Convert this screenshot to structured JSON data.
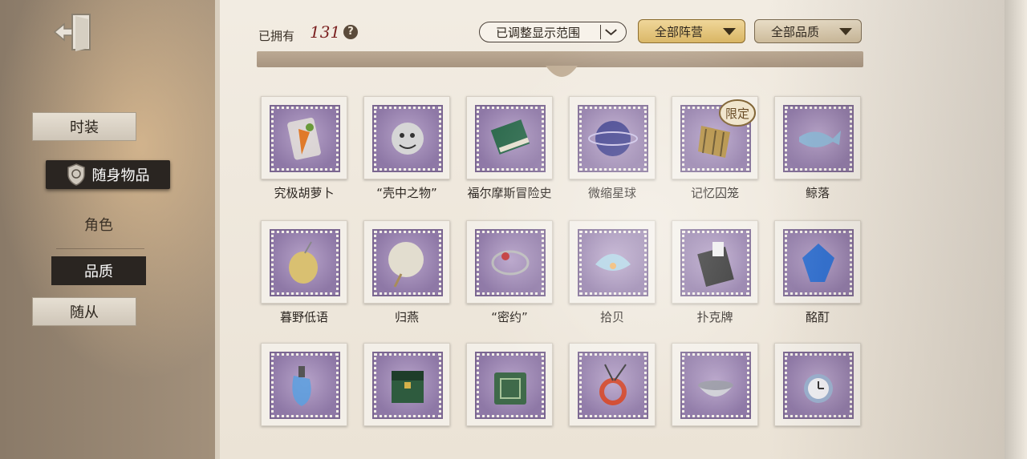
{
  "sidebar": {
    "items": [
      {
        "label": "时装"
      },
      {
        "label": "随身物品"
      },
      {
        "label": "角色"
      },
      {
        "label": "品质"
      },
      {
        "label": "随从"
      }
    ]
  },
  "header": {
    "owned_label": "已拥有",
    "owned_count": "131",
    "help": "?",
    "range_filter": "已调整显示范围",
    "camp_filter": "全部阵营",
    "quality_filter": "全部品质"
  },
  "items": [
    {
      "name": "究极胡萝卜",
      "icon": "carrot-jar-icon",
      "color": "#e07a2a"
    },
    {
      "name": "“壳中之物”",
      "icon": "creature-icon",
      "color": "#d6d6d6"
    },
    {
      "name": "福尔摩斯冒险史",
      "icon": "book-icon",
      "color": "#2e6b4e"
    },
    {
      "name": "微缩星球",
      "icon": "planet-icon",
      "color": "#3a3a8a"
    },
    {
      "name": "记忆囚笼",
      "icon": "cage-icon",
      "color": "#b08a3a",
      "badge": "限定"
    },
    {
      "name": "鲸落",
      "icon": "whale-icon",
      "color": "#8fb6d6"
    },
    {
      "name": "暮野低语",
      "icon": "pendant-icon",
      "color": "#d9c071"
    },
    {
      "name": "归燕",
      "icon": "fan-icon",
      "color": "#e2ddcf"
    },
    {
      "name": "“密约”",
      "icon": "chain-icon",
      "color": "#c23b3b"
    },
    {
      "name": "拾贝",
      "icon": "shell-icon",
      "color": "#a9cfe3"
    },
    {
      "name": "扑克牌",
      "icon": "cards-icon",
      "color": "#2a2a2a"
    },
    {
      "name": "酩酊",
      "icon": "gem-icon",
      "color": "#2f6fd1"
    },
    {
      "name": "",
      "icon": "bottle-icon",
      "color": "#5aa0e0"
    },
    {
      "name": "",
      "icon": "chest-icon",
      "color": "#2e5b3e"
    },
    {
      "name": "",
      "icon": "tome-icon",
      "color": "#3f6a4a"
    },
    {
      "name": "",
      "icon": "ring-icon",
      "color": "#d0452a"
    },
    {
      "name": "",
      "icon": "bowl-icon",
      "color": "#cfcfd6"
    },
    {
      "name": "",
      "icon": "watch-icon",
      "color": "#9ab0cf"
    }
  ]
}
